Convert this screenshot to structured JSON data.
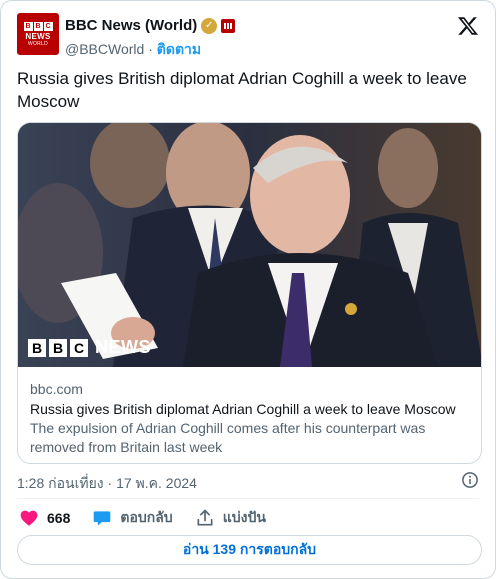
{
  "author": {
    "display_name": "BBC News (World)",
    "handle": "@BBCWorld",
    "separator": " · ",
    "follow_label": "ติดตาม",
    "avatar": {
      "line1": [
        "B",
        "B",
        "C"
      ],
      "line2": "NEWS",
      "line3": "WORLD"
    }
  },
  "tweet": {
    "text": "Russia gives British diplomat Adrian Coghill a week to leave Moscow",
    "timestamp": "1:28 ก่อนเที่ยง · 17 พ.ค. 2024"
  },
  "link_card": {
    "image_logo": {
      "blocks": [
        "B",
        "B",
        "C"
      ],
      "wordmark": "NEWS"
    },
    "domain": "bbc.com",
    "title": "Russia gives British diplomat Adrian Coghill a week to leave Moscow",
    "description": "The expulsion of Adrian Coghill comes after his counterpart was removed from Britain last week"
  },
  "actions": {
    "likes": "668",
    "reply_label": "ตอบกลับ",
    "share_label": "แบ่งปัน"
  },
  "read_replies_label": "อ่าน 139 การตอบกลับ",
  "colors": {
    "like": "#f91880",
    "reply": "#1d9bf0",
    "follow": "#1d9bf0",
    "bbc_red": "#b80000",
    "verified": "#d4a73a",
    "link_blue": "#006fd6"
  },
  "icons": [
    "x-logo-icon",
    "verified-badge-icon",
    "affiliate-badge-icon",
    "info-icon",
    "heart-icon",
    "reply-bubble-icon",
    "share-icon"
  ]
}
